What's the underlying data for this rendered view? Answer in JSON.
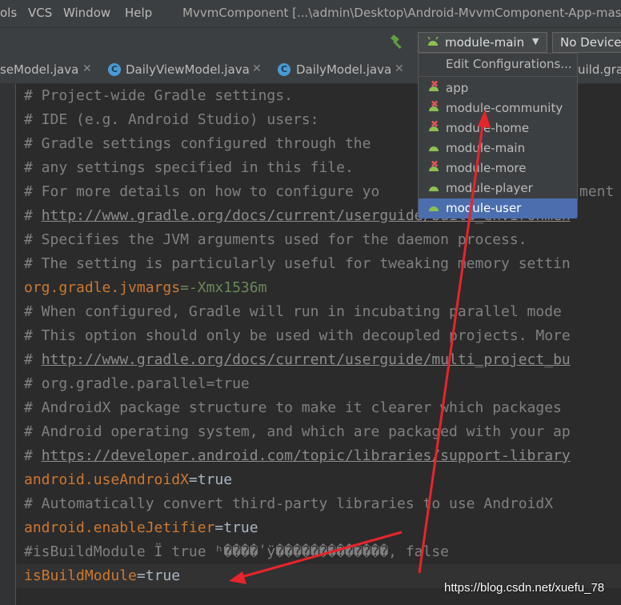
{
  "menubar": {
    "items": [
      "ols",
      "VCS",
      "Window",
      "Help"
    ],
    "title": "MvvmComponent [...\\admin\\Desktop\\Android-MvvmComponent-App-mas"
  },
  "toolbar": {
    "config_selected": "module-main",
    "device": "No Device",
    "build_icon": "hammer-icon"
  },
  "tabs": [
    {
      "label": "seModel.java",
      "icon": ""
    },
    {
      "label": "DailyViewModel.java",
      "icon": "class-icon"
    },
    {
      "label": "DailyModel.java",
      "icon": "class-icon"
    },
    {
      "label": "uild.grac",
      "icon": ""
    }
  ],
  "dropdown": {
    "edit_label": "Edit Configurations...",
    "items": [
      {
        "label": "app",
        "error": true
      },
      {
        "label": "module-community",
        "error": true
      },
      {
        "label": "module-home",
        "error": true
      },
      {
        "label": "module-main",
        "error": false
      },
      {
        "label": "module-more",
        "error": true
      },
      {
        "label": "module-player",
        "error": false
      },
      {
        "label": "module-user",
        "error": false,
        "selected": true
      }
    ]
  },
  "code": {
    "l1": "# Project-wide Gradle settings.",
    "l2": "# IDE (e.g. Android Studio) users:",
    "l3": "# Gradle settings configured through the                    le*",
    "l4": "# any settings specified in this file.",
    "l5a": "# For more details on how to configure yo",
    "l5b": "ment v",
    "l6a": "# ",
    "l6b": "http://www.gradle.org/docs/current/userguide/build_environmen",
    "l7": "# Specifies the JVM arguments used for the daemon process.",
    "l8": "# The setting is particularly useful for tweaking memory settin",
    "l9k": "org.gradle.jvmargs",
    "l9v": "=-Xmx1536m",
    "l10": "# When configured, Gradle will run in incubating parallel mode",
    "l11": "# This option should only be used with decoupled projects. More",
    "l12a": "# ",
    "l12b": "http://www.gradle.org/docs/current/userguide/multi_project_bu",
    "l13": "# org.gradle.parallel=true",
    "l14": "# AndroidX package structure to make it clearer which packages",
    "l15": "# Android operating system, and which are packaged with your ap",
    "l16a": "# ",
    "l16b": "https://developer.android.com/topic/libraries/support-library",
    "l17k": "android.useAndroidX",
    "l17v": "=true",
    "l18": "# Automatically convert third-party libraries to use AndroidX",
    "l19k": "android.enableJetifier",
    "l19v": "=true",
    "l20": "#isBuildModule Ï true ʰ����ʹÿ�������������, false",
    "l21k": "isBuildModule",
    "l21v": "=true"
  },
  "watermark": "https://blog.csdn.net/xuefu_78",
  "colors": {
    "annotation_arrow": "#e8242c",
    "selection": "#4b6eaf",
    "keyword": "#cc7832",
    "comment": "#808080"
  }
}
